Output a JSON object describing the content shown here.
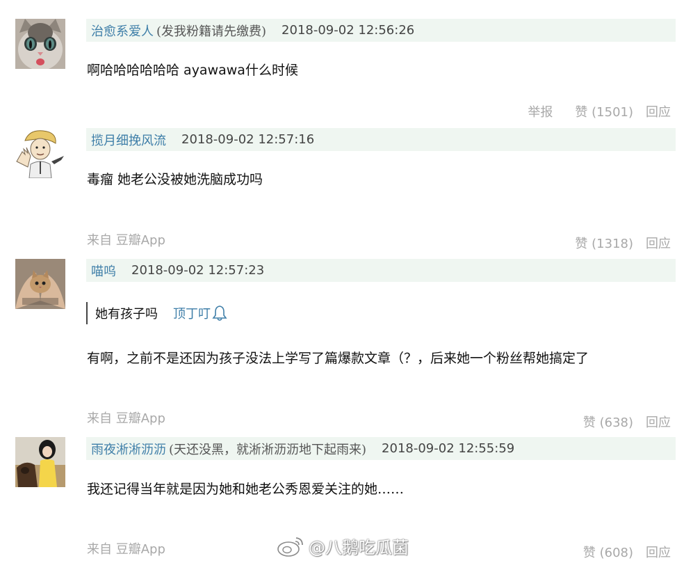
{
  "comments": [
    {
      "username": "治愈系爱人",
      "signature": "(发我粉籍请先缴费)",
      "time": "2018-09-02 12:56:26",
      "text_pre": "啊哈哈哈哈哈哈 ",
      "text_latin": "ayawawa",
      "text_post": "什么时候",
      "report": "举报",
      "like": "赞 (1501)",
      "reply": "回应"
    },
    {
      "username": "揽月细挽风流",
      "time": "2018-09-02 12:57:16",
      "text": "毒瘤 她老公没被她洗脑成功吗",
      "source": "来自 豆瓣App",
      "like": "赞 (1318)",
      "reply": "回应"
    },
    {
      "username": "喵呜",
      "time": "2018-09-02 12:57:23",
      "quote_text": "她有孩子吗",
      "quote_author": "顶丁叮",
      "text": "有啊，之前不是还因为孩子没法上学写了篇爆款文章（？，后来她一个粉丝帮她搞定了",
      "source": "来自 豆瓣App",
      "like": "赞 (638)",
      "reply": "回应"
    },
    {
      "username": "雨夜淅淅沥沥",
      "signature": "(天还没黑，就淅淅沥沥地下起雨来)",
      "time": "2018-09-02 12:55:59",
      "text": "我还记得当年就是因为她和她老公秀恩爱关注的她……",
      "source": "来自 豆瓣App",
      "like": "赞 (608)",
      "reply": "回应"
    }
  ],
  "watermark": "@八鹅吃瓜菌",
  "colors": {
    "header_bg": "#eff6f1",
    "username": "#3e7ea8",
    "muted": "#a8a8a8"
  },
  "icons": [
    "avatar-cat",
    "avatar-cartoon-man",
    "avatar-kitten-hands",
    "avatar-woman-horse",
    "bell-icon",
    "weibo-logo-icon"
  ]
}
